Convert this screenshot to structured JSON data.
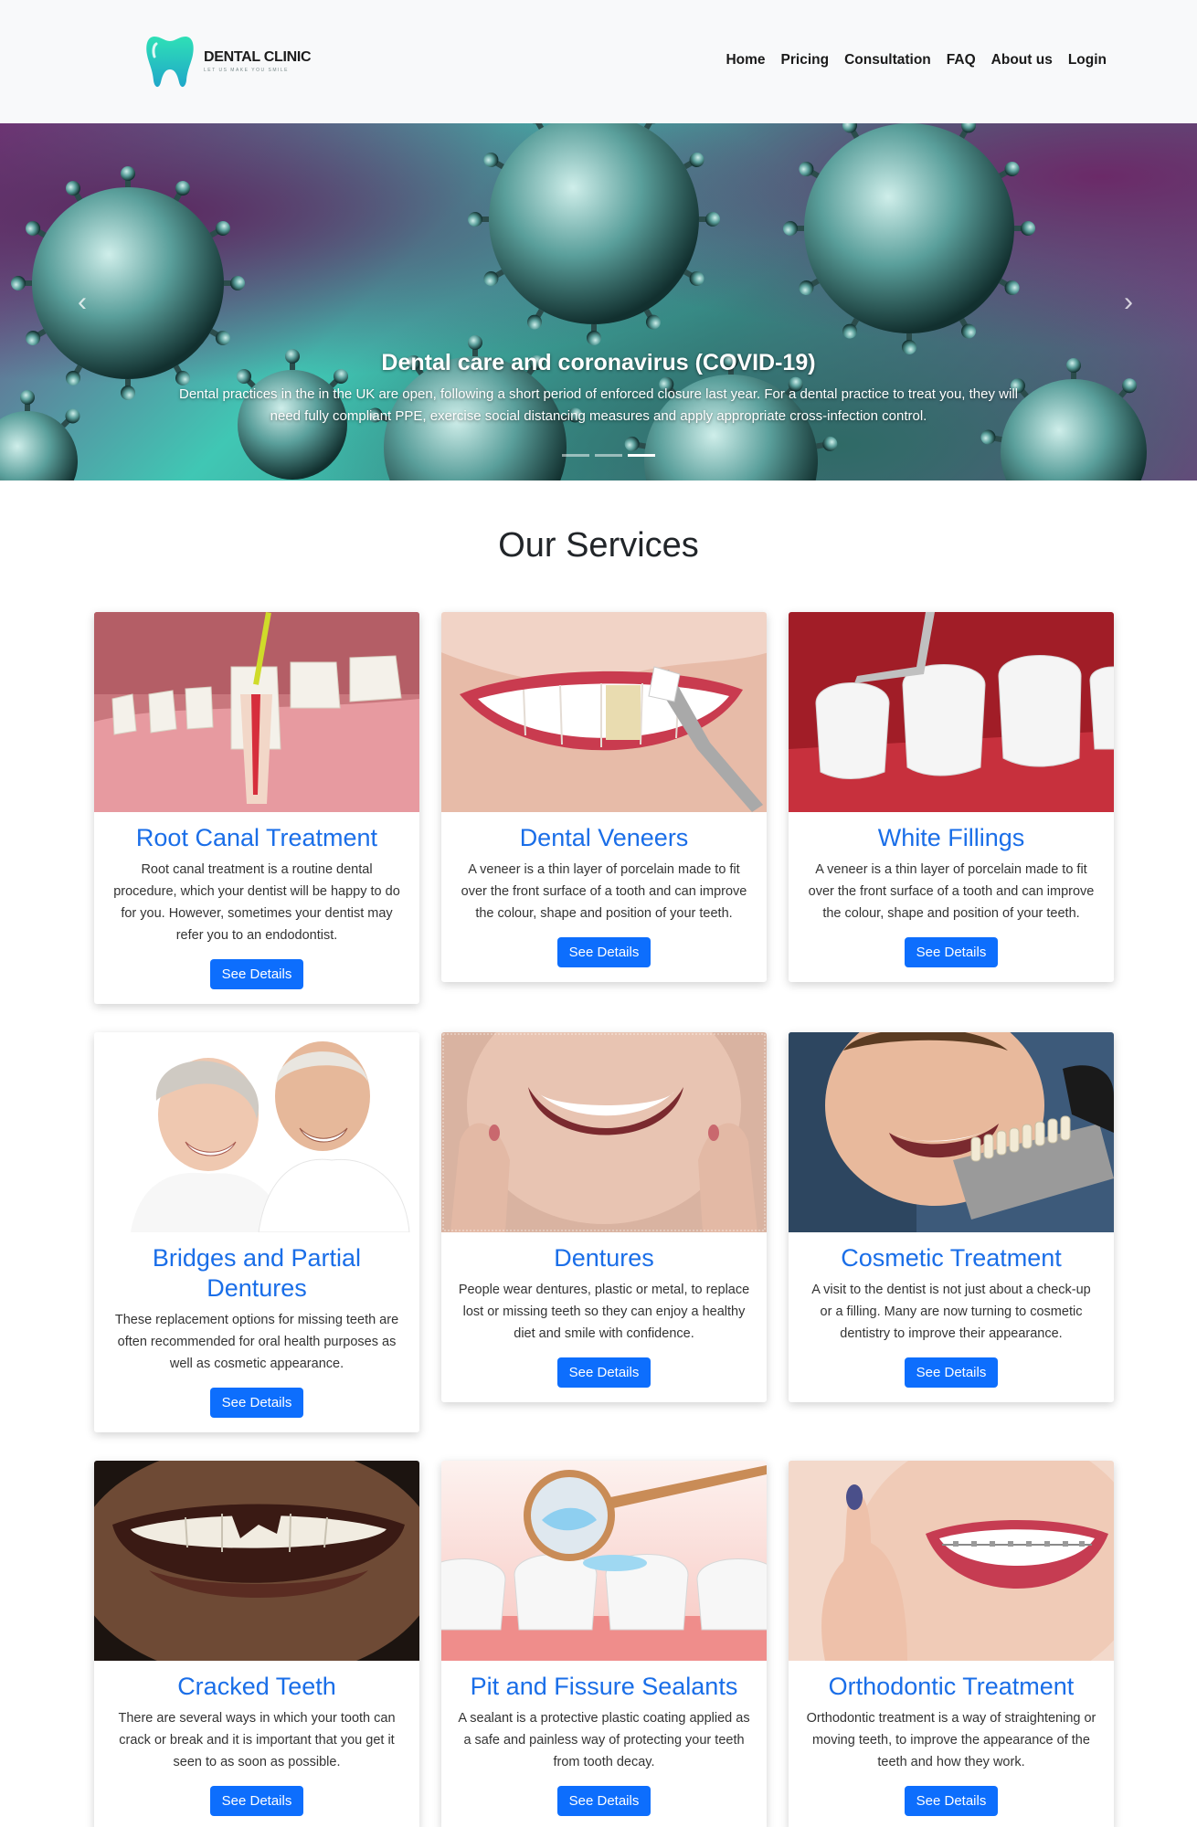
{
  "brand": {
    "name": "DENTAL CLINIC",
    "tagline": "LET US MAKE YOU SMILE",
    "logo_color": "#29d3b0"
  },
  "nav": {
    "links": [
      "Home",
      "Pricing",
      "Consultation",
      "FAQ",
      "About us",
      "Login"
    ]
  },
  "hero": {
    "title": "Dental care and coronavirus (COVID-19)",
    "text": "Dental practices in the in the UK are open, following a short period of enforced closure last year. For a dental practice to treat you, they will need fully compliant PPE, exercise social distancing measures and apply appropriate cross-infection control.",
    "active_slide": 3,
    "slide_count": 3,
    "prev_icon": "chevron-left-icon",
    "next_icon": "chevron-right-icon"
  },
  "services": {
    "title": "Our Services",
    "button_label": "See Details",
    "accent_color": "#1a6ee8",
    "button_color": "#0d6efd",
    "cards": [
      {
        "title": "Root Canal Treatment",
        "text": "Root canal treatment is a routine dental procedure, which your dentist will be happy to do for you. However, sometimes your dentist may refer you to an endodontist.",
        "image": "root-canal-image"
      },
      {
        "title": "Dental Veneers",
        "text": "A veneer is a thin layer of porcelain made to fit over the front surface of a tooth and can improve the colour, shape and position of your teeth.",
        "image": "veneers-image"
      },
      {
        "title": "White Fillings",
        "text": "A veneer is a thin layer of porcelain made to fit over the front surface of a tooth and can improve the colour, shape and position of your teeth.",
        "image": "white-fillings-image"
      },
      {
        "title": "Bridges and Partial Dentures",
        "text": "These replacement options for missing teeth are often recommended for oral health purposes as well as cosmetic appearance.",
        "image": "bridges-image"
      },
      {
        "title": "Dentures",
        "text": "People wear dentures, plastic or metal, to replace lost or missing teeth so they can enjoy a healthy diet and smile with confidence.",
        "image": "dentures-image"
      },
      {
        "title": "Cosmetic Treatment",
        "text": "A visit to the dentist is not just about a check-up or a filling. Many are now turning to cosmetic dentistry to improve their appearance.",
        "image": "cosmetic-image"
      },
      {
        "title": "Cracked Teeth",
        "text": "There are several ways in which your tooth can crack or break and it is important that you get it seen to as soon as possible.",
        "image": "cracked-teeth-image"
      },
      {
        "title": "Pit and Fissure Sealants",
        "text": "A sealant is a protective plastic coating applied as a safe and painless way of protecting your teeth from tooth decay.",
        "image": "sealants-image"
      },
      {
        "title": "Orthodontic Treatment",
        "text": "Orthodontic treatment is a way of straightening or moving teeth, to improve the appearance of the teeth and how they work.",
        "image": "orthodontic-image"
      }
    ]
  }
}
